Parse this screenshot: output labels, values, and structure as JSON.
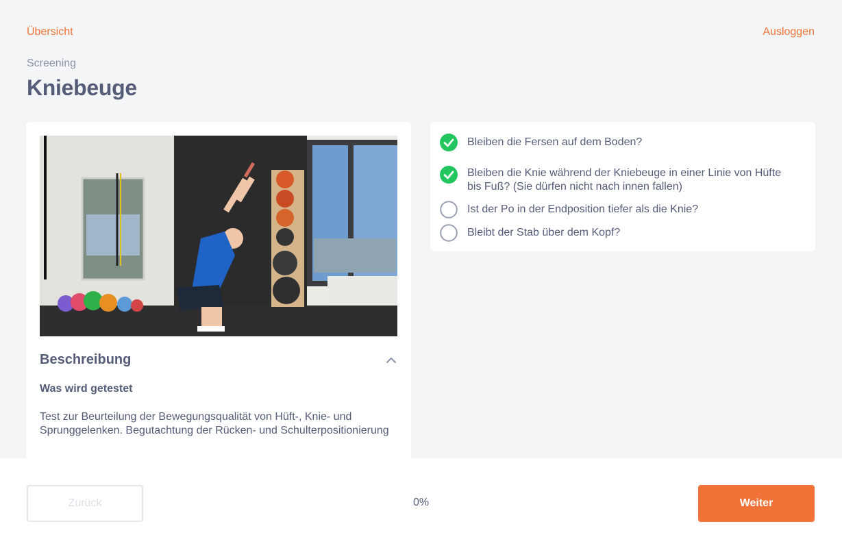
{
  "nav": {
    "overview_label": "Übersicht",
    "logout_label": "Ausloggen"
  },
  "page": {
    "eyebrow": "Screening",
    "title": "Kniebeuge"
  },
  "description": {
    "heading": "Beschreibung",
    "subheading": "Was wird getestet",
    "text": "Test zur Beurteilung der Bewegungsqualität von Hüft-, Knie- und Sprunggelenken. Begutachtung der Rücken- und Schulterpositionierung",
    "expanded": true
  },
  "checklist": [
    {
      "label": "Bleiben die Fersen auf dem Boden?",
      "checked": true
    },
    {
      "label": "Bleiben die Knie während der Kniebeuge in einer Linie von Hüfte bis Fuß? (Sie dürfen nicht nach innen fallen)",
      "checked": true
    },
    {
      "label": "Ist der Po in der Endposition tiefer als die Knie?",
      "checked": false
    },
    {
      "label": "Bleibt der Stab über dem Kopf?",
      "checked": false
    }
  ],
  "footer": {
    "back_label": "Zurück",
    "progress_text": "0%",
    "next_label": "Weiter"
  },
  "colors": {
    "accent": "#f07236",
    "check_green": "#22c55e",
    "heading": "#545c78"
  },
  "icons": {
    "collapse": "chevron-up-icon",
    "checked": "check-circle-icon",
    "unchecked": "empty-circle-icon"
  }
}
